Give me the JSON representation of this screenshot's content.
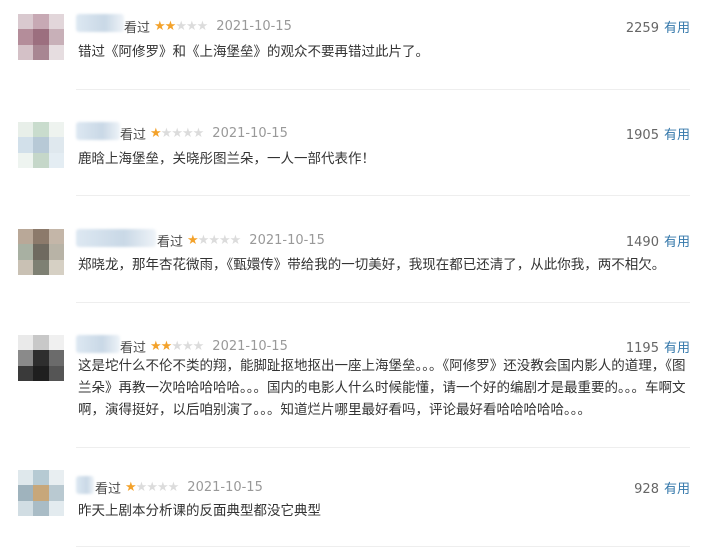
{
  "reviews": [
    {
      "seen_label": "看过",
      "rating": 2,
      "date": "2021-10-15",
      "votes": "2259",
      "useful_label": "有用",
      "text": "错过《阿修罗》和《上海堡垒》的观众不要再错过此片了。"
    },
    {
      "seen_label": "看过",
      "rating": 1,
      "date": "2021-10-15",
      "votes": "1905",
      "useful_label": "有用",
      "text": "鹿晗上海堡垒，关晓彤图兰朵，一人一部代表作！"
    },
    {
      "seen_label": "看过",
      "rating": 1,
      "date": "2021-10-15",
      "votes": "1490",
      "useful_label": "有用",
      "text": "郑晓龙，那年杏花微雨，《甄嬛传》带给我的一切美好，我现在都已还清了，从此你我，两不相欠。"
    },
    {
      "seen_label": "看过",
      "rating": 2,
      "date": "2021-10-15",
      "votes": "1195",
      "useful_label": "有用",
      "text": "这是坨什么不伦不类的翔，能脚趾抠地抠出一座上海堡垒。。。《阿修罗》还没教会国内影人的道理，《图兰朵》再教一次哈哈哈哈哈。。。国内的电影人什么时候能懂，请一个好的编剧才是最重要的。。。车啊文啊，演得挺好，以后咱别演了。。。知道烂片哪里最好看吗，评论最好看哈哈哈哈哈。。。"
    },
    {
      "seen_label": "看过",
      "rating": 1,
      "date": "2021-10-15",
      "votes": "928",
      "useful_label": "有用",
      "text": "昨天上剧本分析课的反面典型都没它典型"
    }
  ],
  "colors": {
    "star_on": "#f3a22b",
    "star_off": "#dcdcdc",
    "link": "#3377aa",
    "separator": "#eeeeee"
  }
}
